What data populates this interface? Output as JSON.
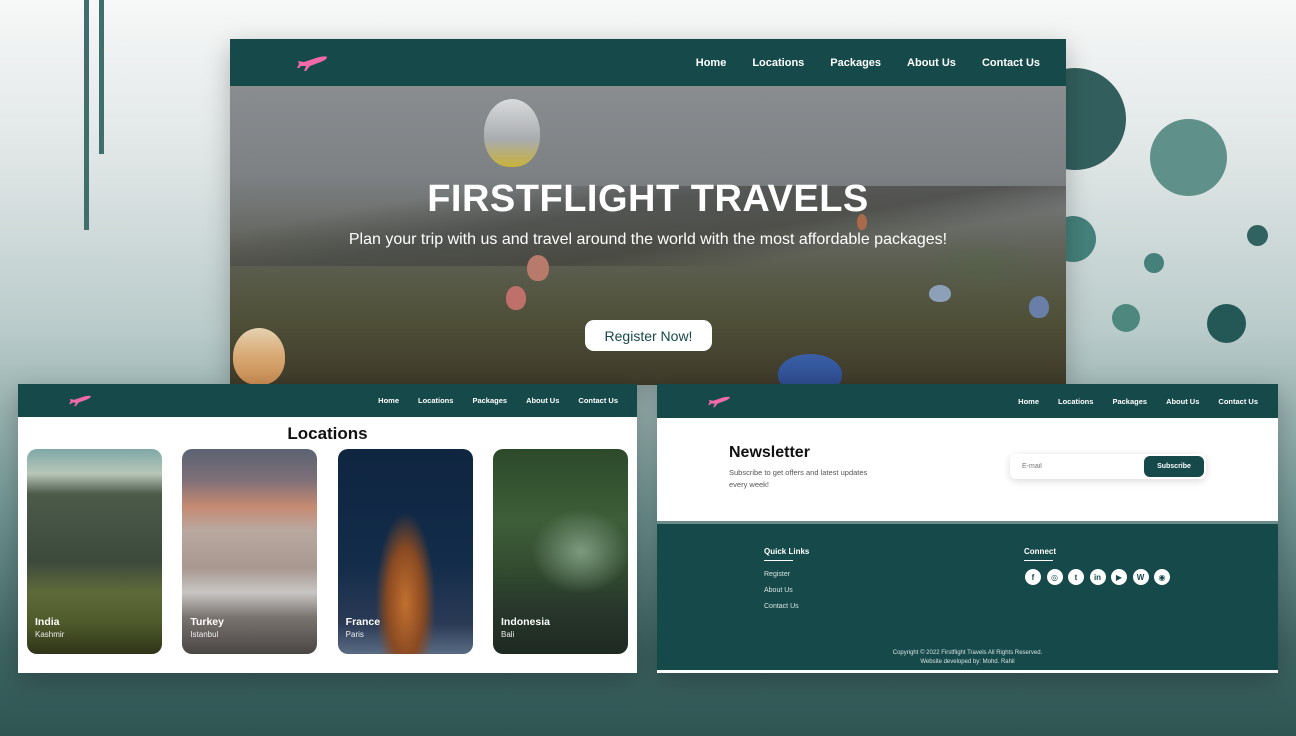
{
  "brand": {
    "accent": "#16494a",
    "logo_color": "#f06aa8"
  },
  "nav": {
    "items": [
      "Home",
      "Locations",
      "Packages",
      "About Us",
      "Contact Us"
    ]
  },
  "hero": {
    "title": "FIRSTFLIGHT TRAVELS",
    "subtitle": "Plan your trip with us and travel around the world with the most affordable packages!",
    "cta_label": "Register Now!"
  },
  "locations": {
    "title": "Locations",
    "cards": [
      {
        "country": "India",
        "city": "Kashmir"
      },
      {
        "country": "Turkey",
        "city": "Istanbul"
      },
      {
        "country": "France",
        "city": "Paris"
      },
      {
        "country": "Indonesia",
        "city": "Bali"
      }
    ]
  },
  "newsletter": {
    "title": "Newsletter",
    "description": "Subscribe to get offers and latest updates every week!",
    "email_placeholder": "E-mail",
    "subscribe_label": "Subscribe"
  },
  "footer": {
    "quick_links_title": "Quick Links",
    "quick_links": [
      "Register",
      "About Us",
      "Contact Us"
    ],
    "connect_title": "Connect",
    "socials": [
      {
        "name": "facebook",
        "glyph": "f"
      },
      {
        "name": "instagram",
        "glyph": "◎"
      },
      {
        "name": "twitter",
        "glyph": "t"
      },
      {
        "name": "linkedin",
        "glyph": "in"
      },
      {
        "name": "youtube",
        "glyph": "▶"
      },
      {
        "name": "wordpress",
        "glyph": "W"
      },
      {
        "name": "github",
        "glyph": "◉"
      }
    ],
    "copyright": "Copyright © 2022 Firstflight Travels All Rights Reserved.",
    "developer": "Website developed by: Mohd. Rahil"
  }
}
